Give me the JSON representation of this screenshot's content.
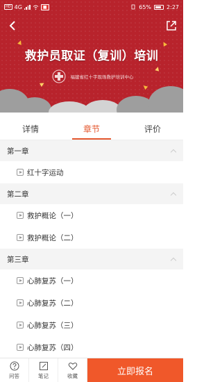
{
  "status_bar": {
    "battery": "65%",
    "time": "2:27",
    "hd": "HD",
    "network": "4G"
  },
  "banner": {
    "title": "救护员取证（复训）培训",
    "subtitle": "福建省红十字现场救护培训中心",
    "colors": {
      "background": "#b8232c",
      "clouds": "#9e9e9e"
    }
  },
  "tabs": [
    {
      "label": "详情",
      "active": false
    },
    {
      "label": "章节",
      "active": true
    },
    {
      "label": "评价",
      "active": false
    }
  ],
  "chapters": [
    {
      "title": "第一章",
      "lessons": [
        "红十字运动"
      ]
    },
    {
      "title": "第二章",
      "lessons": [
        "救护概论（一）",
        "救护概论（二）"
      ]
    },
    {
      "title": "第三章",
      "lessons": [
        "心肺复苏（一）",
        "心肺复苏（二）",
        "心肺复苏（三）",
        "心肺复苏（四）"
      ]
    }
  ],
  "bottom_bar": {
    "items": [
      {
        "label": "问答",
        "icon": "question-icon"
      },
      {
        "label": "笔记",
        "icon": "note-icon"
      },
      {
        "label": "收藏",
        "icon": "heart-icon"
      }
    ],
    "signup_label": "立即报名",
    "accent_color": "#f0582a"
  }
}
